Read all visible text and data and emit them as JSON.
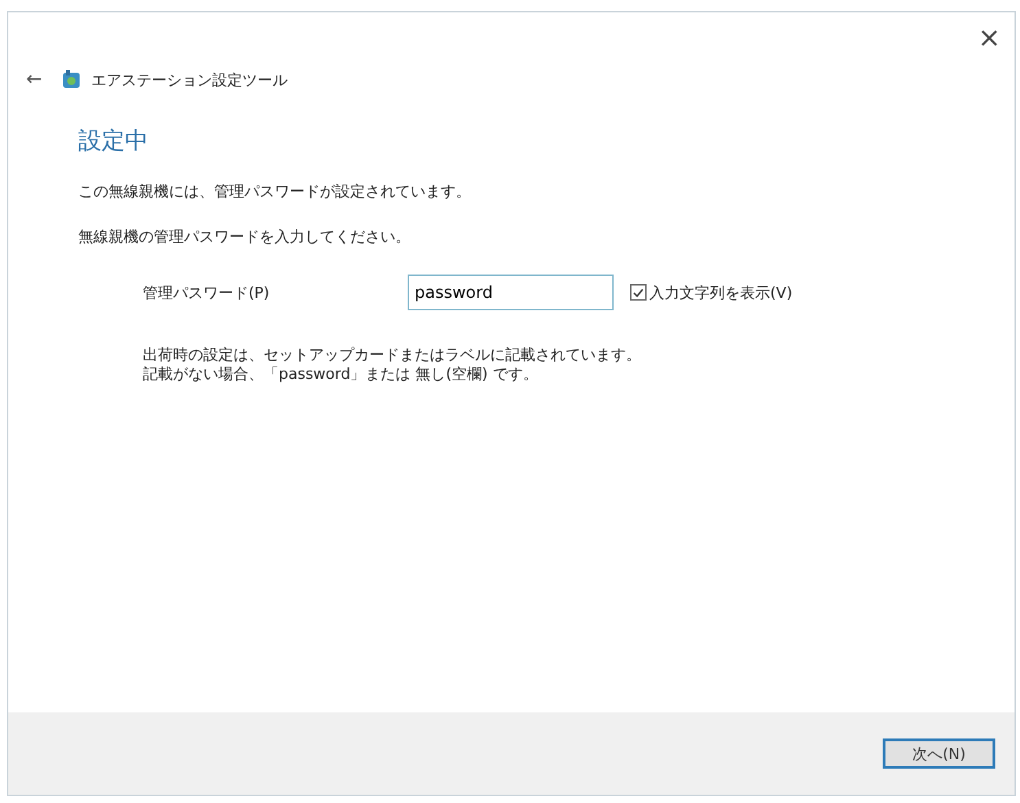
{
  "window": {
    "title": "エアステーション設定ツール",
    "close": "×",
    "back": "←"
  },
  "heading": "設定中",
  "messages": [
    "この無線親機には、管理パスワードが設定されています。",
    "無線親機の管理パスワードを入力してください。"
  ],
  "password": {
    "label": "管理パスワード(P)",
    "value": "password"
  },
  "show_text": {
    "label": "入力文字列を表示(V)",
    "checked": true
  },
  "notes": [
    "出荷時の設定は、セットアップカードまたはラベルに記載されています。",
    "記載がない場合、「password」または 無し(空欄) です。"
  ],
  "buttons": [
    {
      "label": "次へ(N)"
    }
  ]
}
